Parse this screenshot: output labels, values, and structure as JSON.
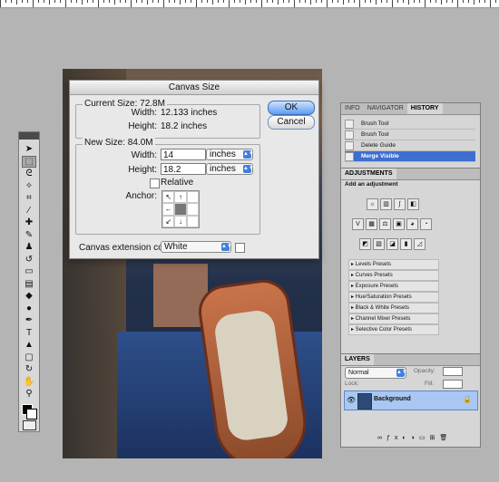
{
  "tools": [
    {
      "icon": "move-tool-icon",
      "glyph": "➤"
    },
    {
      "icon": "marquee-tool-icon",
      "glyph": "⬚"
    },
    {
      "icon": "lasso-tool-icon",
      "glyph": "ᘓ"
    },
    {
      "icon": "magic-wand-icon",
      "glyph": "✧"
    },
    {
      "icon": "crop-tool-icon",
      "glyph": "⌗"
    },
    {
      "icon": "eyedropper-icon",
      "glyph": "⁄"
    },
    {
      "icon": "healing-brush-icon",
      "glyph": "✚"
    },
    {
      "icon": "brush-tool-icon",
      "glyph": "✎"
    },
    {
      "icon": "clone-stamp-icon",
      "glyph": "♟"
    },
    {
      "icon": "history-brush-icon",
      "glyph": "↺"
    },
    {
      "icon": "eraser-icon",
      "glyph": "▭"
    },
    {
      "icon": "gradient-icon",
      "glyph": "▤"
    },
    {
      "icon": "blur-icon",
      "glyph": "◆"
    },
    {
      "icon": "dodge-icon",
      "glyph": "●"
    },
    {
      "icon": "pen-tool-icon",
      "glyph": "✒"
    },
    {
      "icon": "type-tool-icon",
      "glyph": "T"
    },
    {
      "icon": "path-select-icon",
      "glyph": "▲"
    },
    {
      "icon": "shape-tool-icon",
      "glyph": "▢"
    },
    {
      "icon": "3d-rotate-icon",
      "glyph": "↻"
    },
    {
      "icon": "hand-tool-icon",
      "glyph": "✋"
    },
    {
      "icon": "zoom-tool-icon",
      "glyph": "⚲"
    }
  ],
  "dialog": {
    "title": "Canvas Size",
    "current_size": "Current Size: 72.8M",
    "current_width_label": "Width:",
    "current_width": "12.133 inches",
    "current_height_label": "Height:",
    "current_height": "18.2 inches",
    "new_size": "New Size: 84.0M",
    "width_label": "Width:",
    "width_value": "14",
    "width_unit": "inches",
    "height_label": "Height:",
    "height_value": "18.2",
    "height_unit": "inches",
    "relative_label": "Relative",
    "anchor_label": "Anchor:",
    "extension_label": "Canvas extension color:",
    "extension_value": "White",
    "ok_label": "OK",
    "cancel_label": "Cancel"
  },
  "history": {
    "tabs": [
      "INFO",
      "NAVIGATOR",
      "HISTORY"
    ],
    "items": [
      "Brush Tool",
      "Brush Tool",
      "Delete Guide",
      "Merge Visible"
    ]
  },
  "adjustments": {
    "tab": "ADJUSTMENTS",
    "heading": "Add an adjustment",
    "presets": [
      "Levels Presets",
      "Curves Presets",
      "Exposure Presets",
      "Hue/Saturation Presets",
      "Black & White Presets",
      "Channel Mixer Presets",
      "Selective Color Presets"
    ]
  },
  "layers": {
    "tab": "LAYERS",
    "blend_mode": "Normal",
    "opacity_label": "Opacity:",
    "lock_label": "Lock:",
    "fill_label": "Fill:",
    "layer_name": "Background"
  }
}
